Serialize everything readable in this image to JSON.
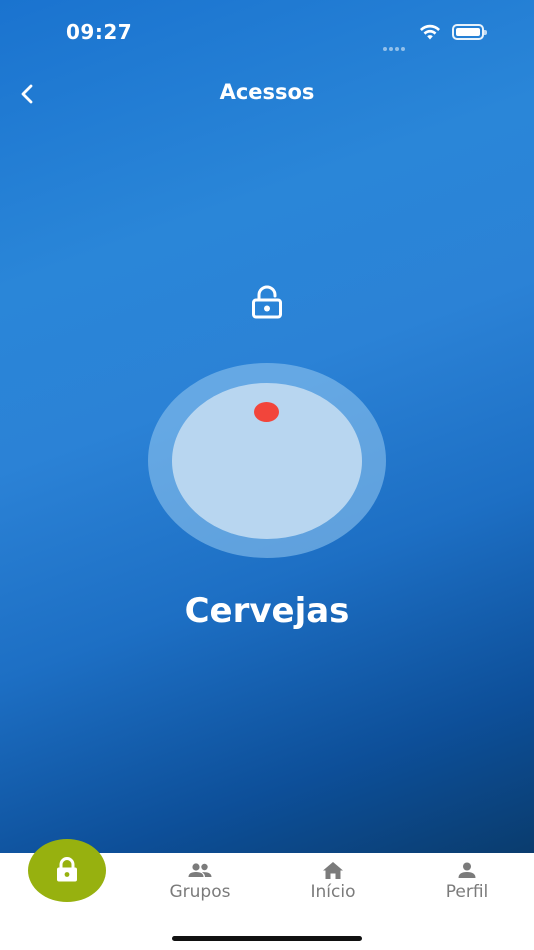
{
  "status_bar": {
    "time": "09:27"
  },
  "header": {
    "title": "Acessos"
  },
  "device": {
    "name": "Cervejas",
    "lock_state": "unlocked"
  },
  "tabbar": {
    "tabs": [
      {
        "label": "Grupos",
        "icon": "group-icon"
      },
      {
        "label": "Início",
        "icon": "home-icon"
      },
      {
        "label": "Perfil",
        "icon": "person-icon"
      }
    ],
    "fab_icon": "lock-icon"
  },
  "colors": {
    "accent_green": "#97b10f",
    "indicator_red": "#f2453b",
    "tab_gray": "#7b7b7b"
  }
}
